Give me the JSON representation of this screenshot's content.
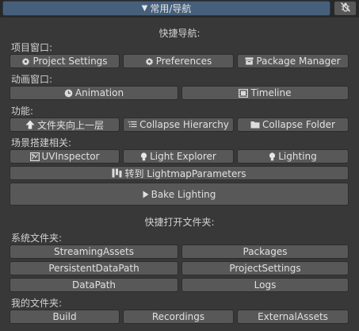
{
  "header": {
    "title": "常用/导航",
    "expand_icon": "triangle-down-icon",
    "toggle_icon": "bug-off-icon"
  },
  "nav": {
    "title": "快捷导航:",
    "project_window": {
      "label": "项目窗口:",
      "buttons": [
        {
          "label": "Project Settings",
          "icon": "gear-icon"
        },
        {
          "label": "Preferences",
          "icon": "gear-icon"
        },
        {
          "label": "Package Manager",
          "icon": "package-icon"
        }
      ]
    },
    "animation_window": {
      "label": "动画窗口:",
      "buttons": [
        {
          "label": "Animation",
          "icon": "clock-icon"
        },
        {
          "label": "Timeline",
          "icon": "film-icon"
        }
      ]
    },
    "functions": {
      "label": "功能:",
      "buttons": [
        {
          "label": "文件夹向上一层",
          "icon": "arrow-up-icon"
        },
        {
          "label": "Collapse Hierarchy",
          "icon": "hierarchy-icon"
        },
        {
          "label": "Collapse Folder",
          "icon": "folder-icon"
        }
      ]
    },
    "scene": {
      "label": "场景搭建相关:",
      "buttons": [
        {
          "label": "UVInspector",
          "icon": "uv-icon"
        },
        {
          "label": "Light Explorer",
          "icon": "lightbulb-icon"
        },
        {
          "label": "Lighting",
          "icon": "lightbulb-icon"
        }
      ],
      "lightmap_button": {
        "label": "转到 LightmapParameters",
        "icon": "lightmap-icon"
      },
      "bake_button": {
        "label": "Bake Lighting",
        "icon": "play-icon"
      }
    }
  },
  "folders": {
    "title": "快捷打开文件夹:",
    "system": {
      "label": "系统文件夹:",
      "buttons": [
        "StreamingAssets",
        "Packages",
        "PersistentDataPath",
        "ProjectSettings",
        "DataPath",
        "Logs"
      ]
    },
    "mine": {
      "label": "我的文件夹:",
      "buttons": [
        "Build",
        "Recordings",
        "ExternalAssets"
      ]
    }
  }
}
